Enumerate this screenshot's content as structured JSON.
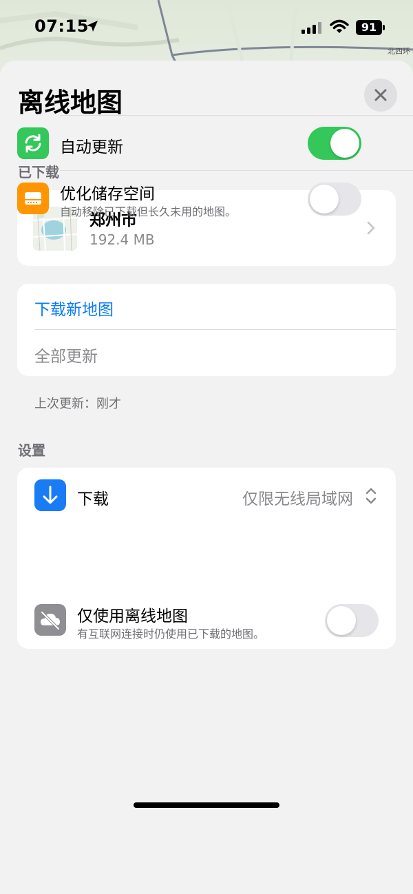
{
  "status_bar": {
    "time": "07:15",
    "battery": "91"
  },
  "map_background": {
    "road_label": "北四环"
  },
  "sheet": {
    "title": "离线地图",
    "downloaded": {
      "header": "已下载",
      "items": [
        {
          "name": "郑州市",
          "size": "192.4 MB"
        }
      ]
    },
    "actions": {
      "download_new": "下载新地图",
      "update_all": "全部更新"
    },
    "last_update": "上次更新：刚才",
    "settings": {
      "header": "设置",
      "download": {
        "label": "下载",
        "value": "仅限无线局域网"
      },
      "auto_update": {
        "label": "自动更新",
        "enabled": true
      },
      "optimize_storage": {
        "label": "优化储存空间",
        "description": "自动移除已下载但长久未用的地图。",
        "enabled": false
      },
      "offline_only": {
        "label": "仅使用离线地图",
        "description": "有互联网连接时仍使用已下载的地图。",
        "enabled": false
      }
    }
  },
  "colors": {
    "accent": "#0a7aff",
    "toggle_on": "#34c759",
    "download_icon_bg": "#1a7cf5",
    "auto_update_icon_bg": "#34c759",
    "storage_icon_bg": "#ff9500",
    "offline_icon_bg": "#8e8e93"
  },
  "icons": {
    "location": "location-arrow-icon",
    "signal": "cellular-signal-icon",
    "wifi": "wifi-icon",
    "close": "close-icon",
    "chevron": "chevron-right-icon",
    "download": "download-arrow-icon",
    "auto_update": "refresh-icon",
    "storage": "storage-drive-icon",
    "offline": "cloud-off-icon",
    "updown": "chevron-up-down-icon"
  }
}
